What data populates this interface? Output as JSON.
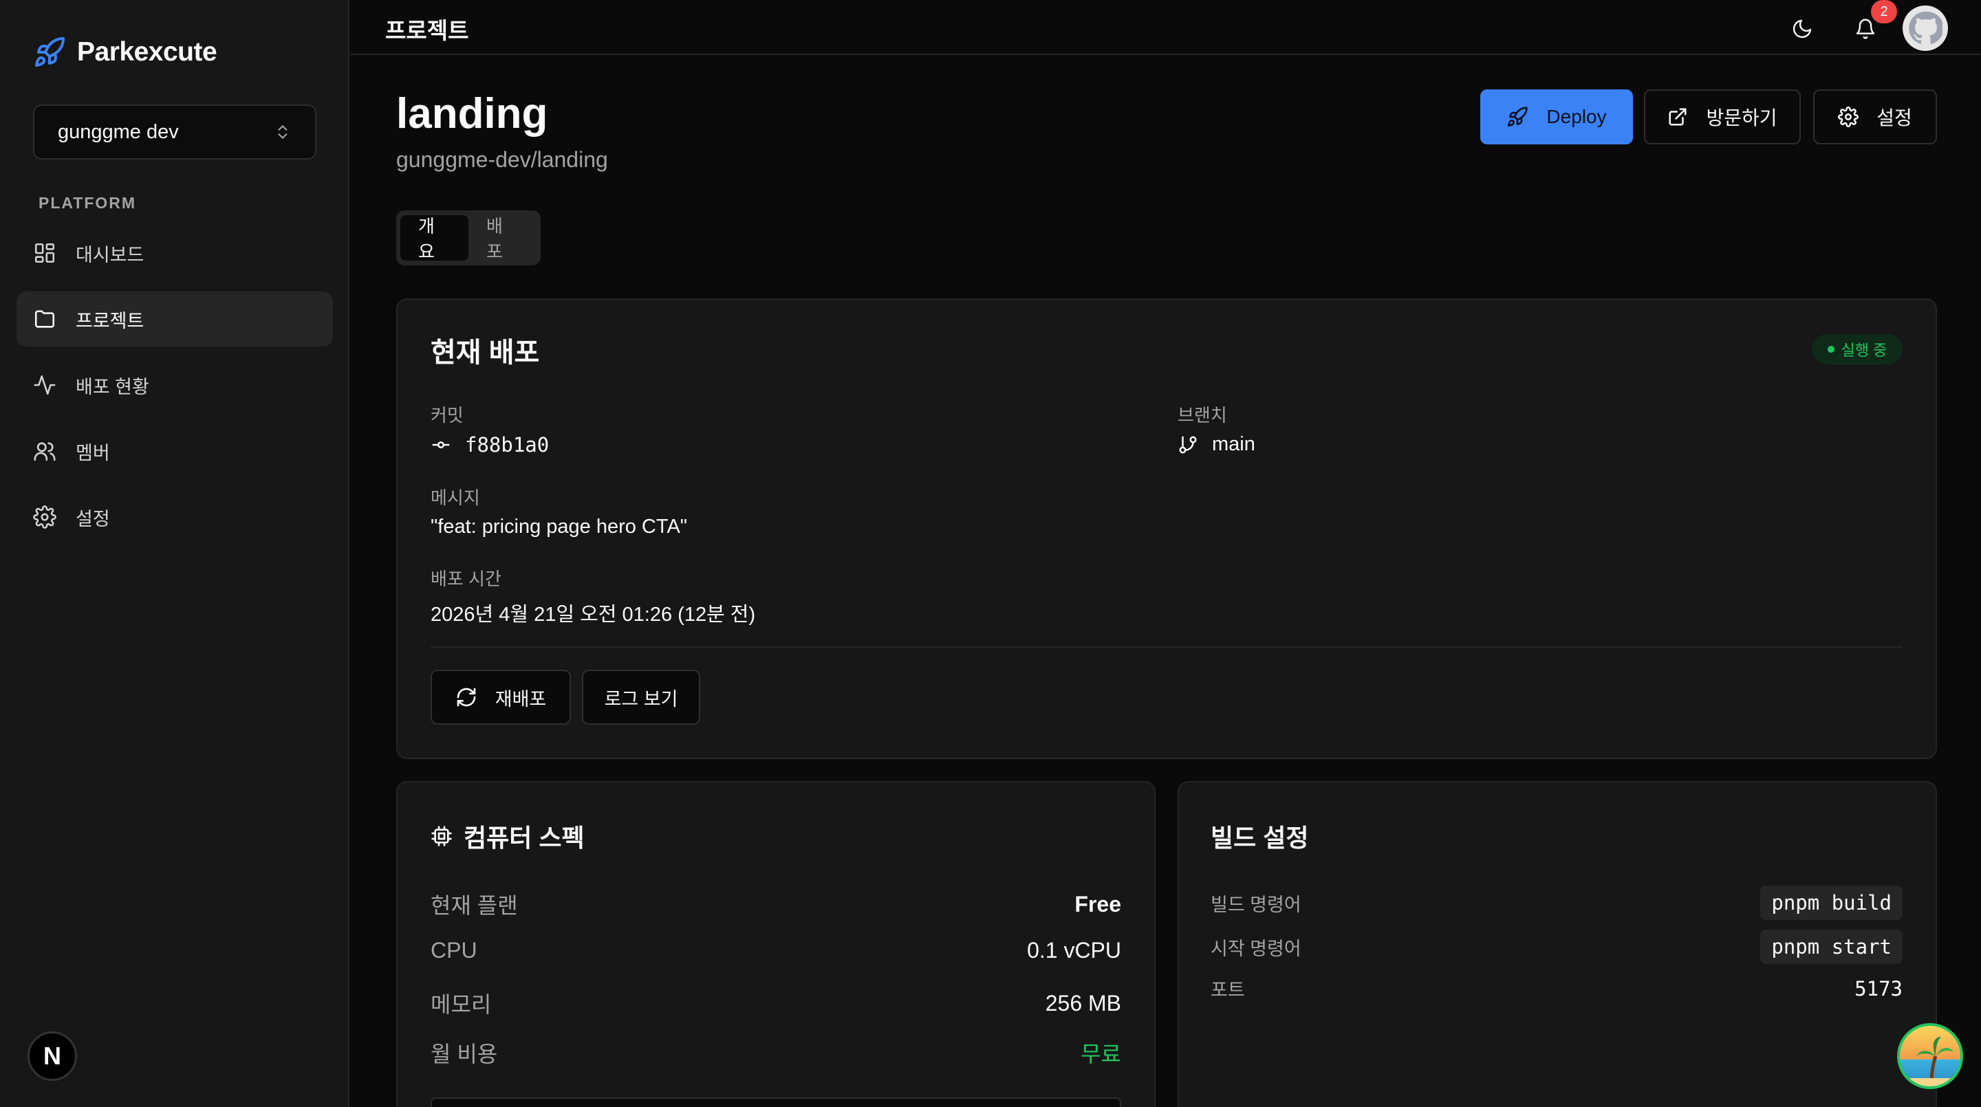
{
  "brand": {
    "name": "Parkexcute"
  },
  "team_select": {
    "value": "gunggme dev"
  },
  "sidebar": {
    "section_label": "PLATFORM",
    "items": [
      {
        "label": "대시보드",
        "icon": "dashboard-icon"
      },
      {
        "label": "프로젝트",
        "icon": "folder-icon",
        "active": true
      },
      {
        "label": "배포 현황",
        "icon": "activity-icon"
      },
      {
        "label": "멤버",
        "icon": "users-icon"
      },
      {
        "label": "설정",
        "icon": "gear-icon"
      }
    ]
  },
  "topbar": {
    "title": "프로젝트",
    "notification_count": "2"
  },
  "next_badge": "N",
  "project": {
    "name": "landing",
    "repo": "gunggme-dev/landing",
    "actions": {
      "deploy": "Deploy",
      "visit": "방문하기",
      "settings": "설정"
    },
    "tabs": [
      {
        "label": "개요",
        "active": true
      },
      {
        "label": "배포"
      }
    ]
  },
  "current_deploy": {
    "title": "현재 배포",
    "status": "실행 중",
    "commit_label": "커밋",
    "commit": "f88b1a0",
    "branch_label": "브랜치",
    "branch": "main",
    "message_label": "메시지",
    "message": "\"feat: pricing page hero CTA\"",
    "time_label": "배포 시간",
    "time": "2026년 4월 21일 오전 01:26 (12분 전)",
    "redeploy": "재배포",
    "logs": "로그 보기"
  },
  "compute": {
    "title": "컴퓨터 스펙",
    "rows": [
      {
        "k": "현재 플랜",
        "v": "Free"
      },
      {
        "k": "CPU",
        "v": "0.1 vCPU"
      },
      {
        "k": "메모리",
        "v": "256 MB"
      },
      {
        "k": "월 비용",
        "v": "무료"
      }
    ]
  },
  "build": {
    "title": "빌드 설정",
    "build_label": "빌드 명령어",
    "build_cmd": "pnpm build",
    "start_label": "시작 명령어",
    "start_cmd": "pnpm start",
    "port_label": "포트",
    "port": "5173"
  },
  "colors": {
    "accent": "#3b82f6",
    "success": "#22c55e",
    "danger": "#ef4444"
  }
}
